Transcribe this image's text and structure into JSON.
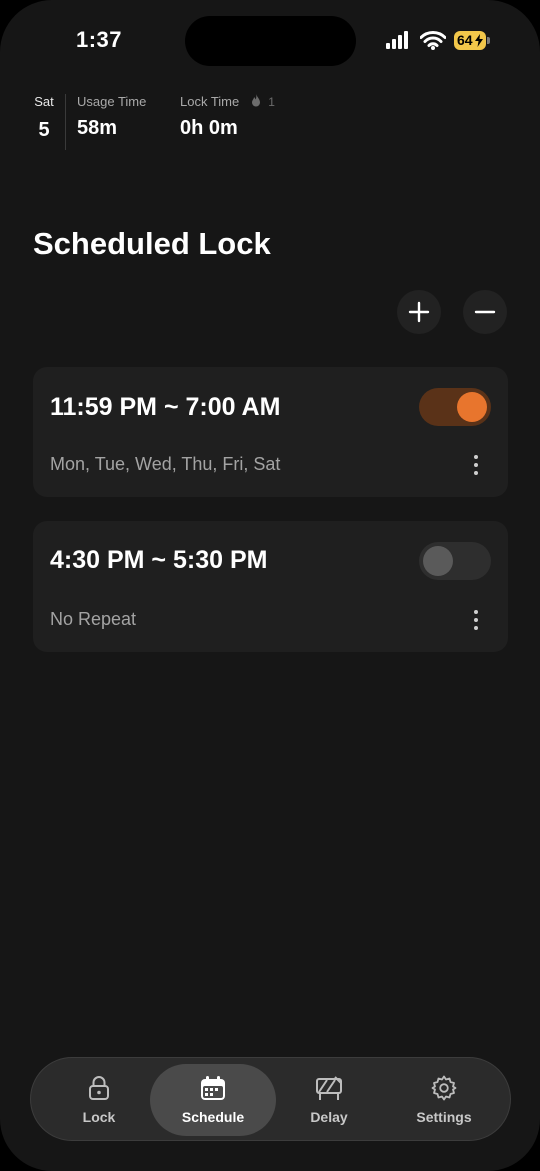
{
  "status_bar": {
    "time": "1:37",
    "battery": "64"
  },
  "stats": {
    "day_label": "Sat",
    "day_number": "5",
    "usage_label": "Usage Time",
    "usage_value": "58m",
    "lock_label": "Lock Time",
    "streak_count": "1",
    "lock_value": "0h 0m"
  },
  "title": "Scheduled Lock",
  "schedules": [
    {
      "time": "11:59 PM ~ 7:00 AM",
      "days": "Mon, Tue, Wed, Thu, Fri, Sat",
      "enabled": true
    },
    {
      "time": "4:30 PM ~ 5:30 PM",
      "days": "No Repeat",
      "enabled": false
    }
  ],
  "tabs": [
    {
      "label": "Lock",
      "icon": "lock-icon"
    },
    {
      "label": "Schedule",
      "icon": "calendar-icon",
      "active": true
    },
    {
      "label": "Delay",
      "icon": "delay-icon"
    },
    {
      "label": "Settings",
      "icon": "gear-icon"
    }
  ],
  "colors": {
    "accent": "#e8752d",
    "background": "#161616",
    "card": "#1f1f1f"
  }
}
